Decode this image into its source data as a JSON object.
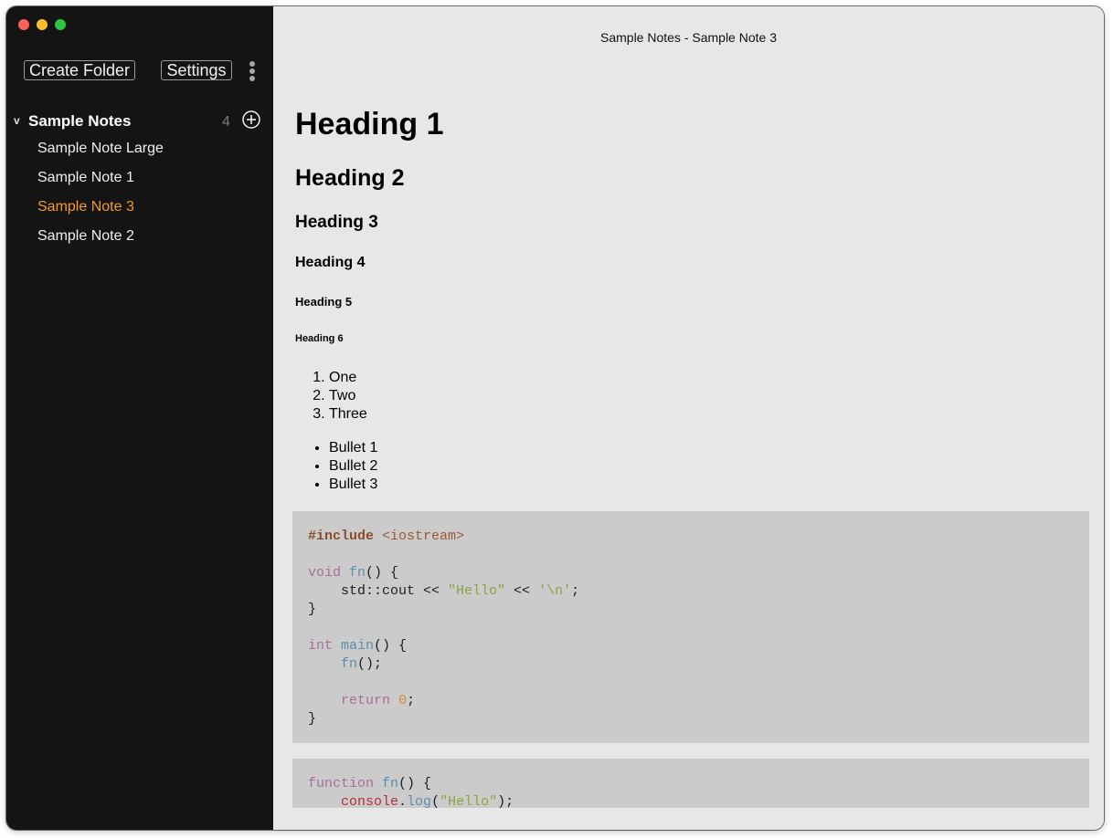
{
  "window": {
    "title": "Sample Notes - Sample Note 3"
  },
  "sidebar": {
    "create_folder_label": "Create Folder",
    "settings_label": "Settings",
    "folder": {
      "name": "Sample Notes",
      "count": "4",
      "chevron": "v"
    },
    "notes": [
      {
        "label": "Sample Note Large"
      },
      {
        "label": "Sample Note 1"
      },
      {
        "label": "Sample Note 3"
      },
      {
        "label": "Sample Note 2"
      }
    ]
  },
  "colors": {
    "sidebar_bg": "#141414",
    "accent": "#f59a24",
    "content_bg": "#e7e7e7",
    "code_bg": "#cbcbcb"
  },
  "icons": {
    "menu": "kebab-menu-icon",
    "add": "plus-circle-icon",
    "chevron": "chevron-down-icon"
  },
  "content": {
    "headings": [
      "Heading 1",
      "Heading 2",
      "Heading 3",
      "Heading 4",
      "Heading 5",
      "Heading 6"
    ],
    "ordered_list": [
      "One",
      "Two",
      "Three"
    ],
    "bullet_list": [
      "Bullet 1",
      "Bullet 2",
      "Bullet 3"
    ],
    "cpp": {
      "l1a": "#include",
      "l1b": " <iostream>",
      "l3a": "void",
      "l3b": " ",
      "l3c": "fn",
      "l3d": "() {",
      "l4a": "    std::cout << ",
      "l4b": "\"Hello\"",
      "l4c": " << ",
      "l4d": "'\\n'",
      "l4e": ";",
      "l5": "}",
      "l7a": "int",
      "l7b": " ",
      "l7c": "main",
      "l7d": "() {",
      "l8a": "    ",
      "l8b": "fn",
      "l8c": "();",
      "l10a": "    ",
      "l10b": "return",
      "l10c": " ",
      "l10d": "0",
      "l10e": ";",
      "l11": "}"
    },
    "js": {
      "l1a": "function",
      "l1b": " ",
      "l1c": "fn",
      "l1d": "() {",
      "l2a": "    ",
      "l2b": "console",
      "l2c": ".",
      "l2d": "log",
      "l2e": "(",
      "l2f": "\"Hello\"",
      "l2g": ");"
    }
  }
}
